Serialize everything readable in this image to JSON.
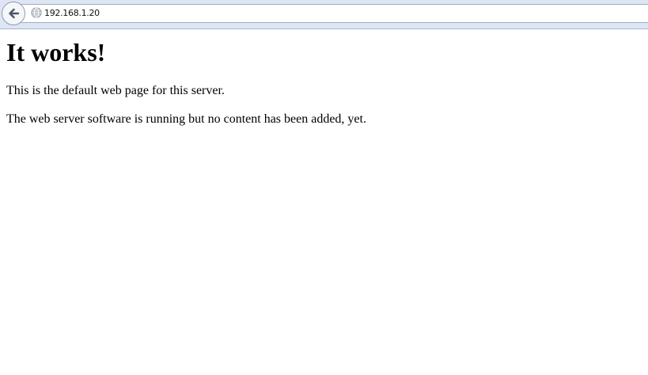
{
  "browser": {
    "address_bar": {
      "url": "192.168.1.20"
    },
    "icons": {
      "back": "back-arrow-icon",
      "site": "globe-icon"
    }
  },
  "page": {
    "heading": "It works!",
    "paragraphs": [
      "This is the default web page for this server.",
      "The web server software is running but no content has been added, yet."
    ]
  }
}
